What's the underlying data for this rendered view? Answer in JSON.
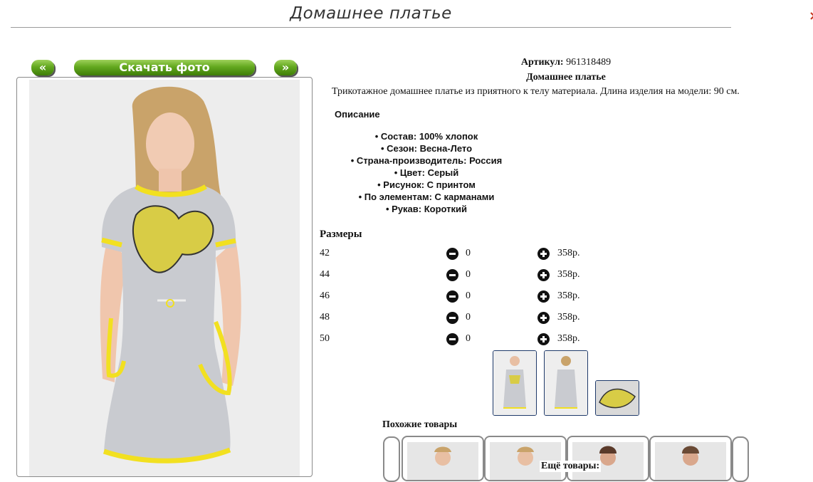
{
  "page": {
    "title": "Домашнее платье",
    "close_icon": "close-icon"
  },
  "gallery": {
    "prev_label": "«",
    "download_label": "Скачать фото",
    "next_label": "»"
  },
  "product": {
    "article_label": "Артикул:",
    "article_value": "961318489",
    "name": "Домашнее платье",
    "description": "Трикотажное домашнее платье из приятного к телу материала. Длина изделия на модели: 90 см."
  },
  "specs": {
    "heading": "Описание",
    "items": [
      "• Состав: 100% хлопок",
      "• Сезон: Весна-Лето",
      "• Страна-производитель: Россия",
      "• Цвет: Серый",
      "• Рисунок: С принтом",
      "• По элементам: С карманами",
      "• Рукав: Короткий"
    ]
  },
  "sizes": {
    "heading": "Размеры",
    "rows": [
      {
        "size": "42",
        "qty": "0",
        "price": "358р."
      },
      {
        "size": "44",
        "qty": "0",
        "price": "358р."
      },
      {
        "size": "46",
        "qty": "0",
        "price": "358р."
      },
      {
        "size": "48",
        "qty": "0",
        "price": "358р."
      },
      {
        "size": "50",
        "qty": "0",
        "price": "358р."
      }
    ]
  },
  "similar": {
    "heading": "Похожие товары",
    "more_heading": "Ещё товары:"
  },
  "colors": {
    "button_green": "#5aa01a",
    "dress_gray": "#c9cbd0",
    "trim_yellow": "#f2e020",
    "thumb_border": "#1f3a6a",
    "close_red": "#c8341e"
  }
}
